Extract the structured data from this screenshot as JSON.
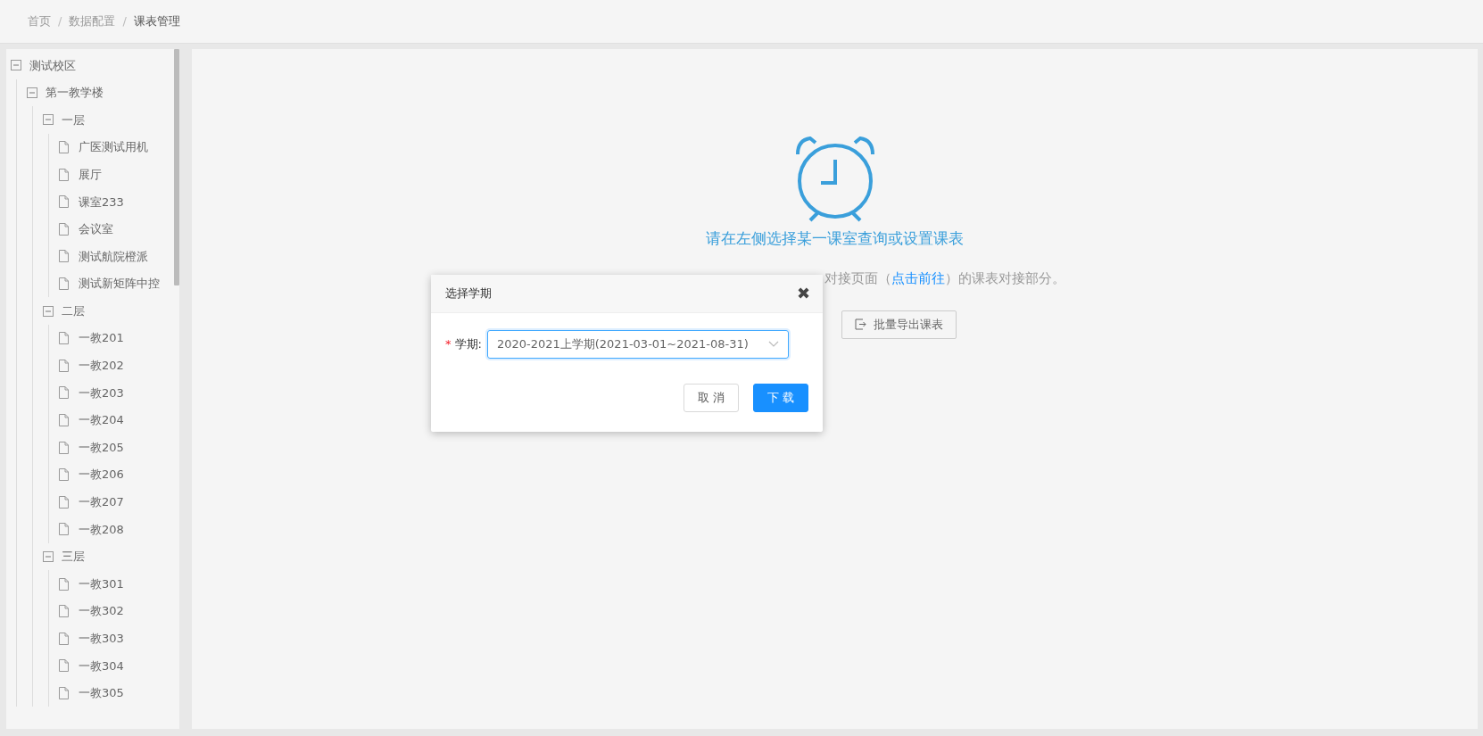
{
  "breadcrumb": [
    {
      "label": "首页",
      "current": false,
      "separator": "/"
    },
    {
      "label": "数据配置",
      "current": false,
      "separator": "/"
    },
    {
      "label": "课表管理",
      "current": true
    }
  ],
  "tree": [
    {
      "label": "测试校区",
      "kind": "folder",
      "expanded": true,
      "children": [
        {
          "label": "第一教学楼",
          "kind": "folder",
          "expanded": true,
          "children": [
            {
              "label": "一层",
              "kind": "folder",
              "expanded": true,
              "children": [
                {
                  "label": "广医测试用机",
                  "kind": "file"
                },
                {
                  "label": "展厅",
                  "kind": "file"
                },
                {
                  "label": "课室233",
                  "kind": "file"
                },
                {
                  "label": "会议室",
                  "kind": "file"
                },
                {
                  "label": "测试航院橙派",
                  "kind": "file"
                },
                {
                  "label": "测试新矩阵中控",
                  "kind": "file"
                }
              ]
            },
            {
              "label": "二层",
              "kind": "folder",
              "expanded": true,
              "children": [
                {
                  "label": "一教201",
                  "kind": "file"
                },
                {
                  "label": "一教202",
                  "kind": "file"
                },
                {
                  "label": "一教203",
                  "kind": "file"
                },
                {
                  "label": "一教204",
                  "kind": "file"
                },
                {
                  "label": "一教205",
                  "kind": "file"
                },
                {
                  "label": "一教206",
                  "kind": "file"
                },
                {
                  "label": "一教207",
                  "kind": "file"
                },
                {
                  "label": "一教208",
                  "kind": "file"
                }
              ]
            },
            {
              "label": "三层",
              "kind": "folder",
              "expanded": true,
              "children": [
                {
                  "label": "一教301",
                  "kind": "file"
                },
                {
                  "label": "一教302",
                  "kind": "file"
                },
                {
                  "label": "一教303",
                  "kind": "file"
                },
                {
                  "label": "一教304",
                  "kind": "file"
                },
                {
                  "label": "一教305",
                  "kind": "file"
                }
              ]
            }
          ]
        }
      ]
    }
  ],
  "empty_state": {
    "heading": "请在左侧选择某一课室查询或设置课表",
    "hint": [
      {
        "kind": "text",
        "text": "对接页面（"
      },
      {
        "kind": "link",
        "text": "点击前往"
      },
      {
        "kind": "text",
        "text": "）的课表对接部分。"
      }
    ],
    "buttons": [
      {
        "label": "批量导出课表"
      }
    ]
  },
  "dialog": {
    "title": "选择学期",
    "close": "✖",
    "field": {
      "label": "学期:",
      "required": true,
      "required_mark": "*",
      "value": "2020-2021上学期(2021-03-01~2021-08-31)"
    },
    "buttons": [
      {
        "label": "取 消",
        "kind": "default"
      },
      {
        "label": "下 载",
        "kind": "primary"
      }
    ]
  }
}
